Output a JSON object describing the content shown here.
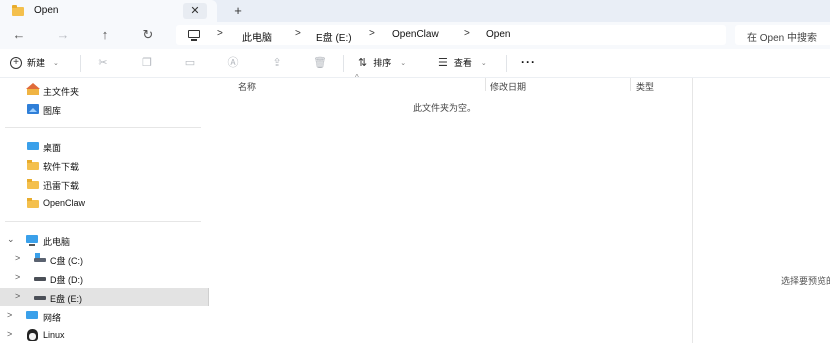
{
  "tab": {
    "title": "Open",
    "close": "✕",
    "new_tab": "+"
  },
  "nav": {
    "back": "←",
    "forward": "→",
    "up": "↑",
    "refresh": "↻"
  },
  "breadcrumb": {
    "separator": ">",
    "items": [
      "此电脑",
      "E盘 (E:)",
      "OpenClaw",
      "Open"
    ]
  },
  "search": {
    "placeholder": "在 Open 中搜索"
  },
  "toolbar": {
    "new_label": "新建",
    "sort_label": "排序",
    "view_label": "查看",
    "more": "···",
    "caret": "⌄"
  },
  "sidebar": {
    "quick": [
      {
        "label": "主文件夹",
        "icon": "home-icon"
      },
      {
        "label": "图库",
        "icon": "gallery-icon"
      }
    ],
    "pinned": [
      {
        "label": "桌面",
        "icon": "desktop-icon"
      },
      {
        "label": "软件下载",
        "icon": "folder-icon"
      },
      {
        "label": "迅雷下载",
        "icon": "folder-icon"
      },
      {
        "label": "OpenClaw",
        "icon": "folder-icon"
      }
    ],
    "this_pc": "此电脑",
    "drives": [
      {
        "label": "C盘 (C:)",
        "icon": "drive-c-icon"
      },
      {
        "label": "D盘 (D:)",
        "icon": "drive-icon"
      },
      {
        "label": "E盘 (E:)",
        "icon": "drive-icon",
        "selected": true
      }
    ],
    "network": "网络",
    "linux": "Linux"
  },
  "columns": {
    "name": "名称",
    "date": "修改日期",
    "type": "类型"
  },
  "content": {
    "empty_message": "此文件夹为空。"
  },
  "preview": {
    "message": "选择要预览的文件。"
  },
  "colors": {
    "tabbar": "#e9eef6",
    "selected": "#e3e3e3",
    "accent": "#3aa0ea",
    "folder": "#f4c04d"
  }
}
